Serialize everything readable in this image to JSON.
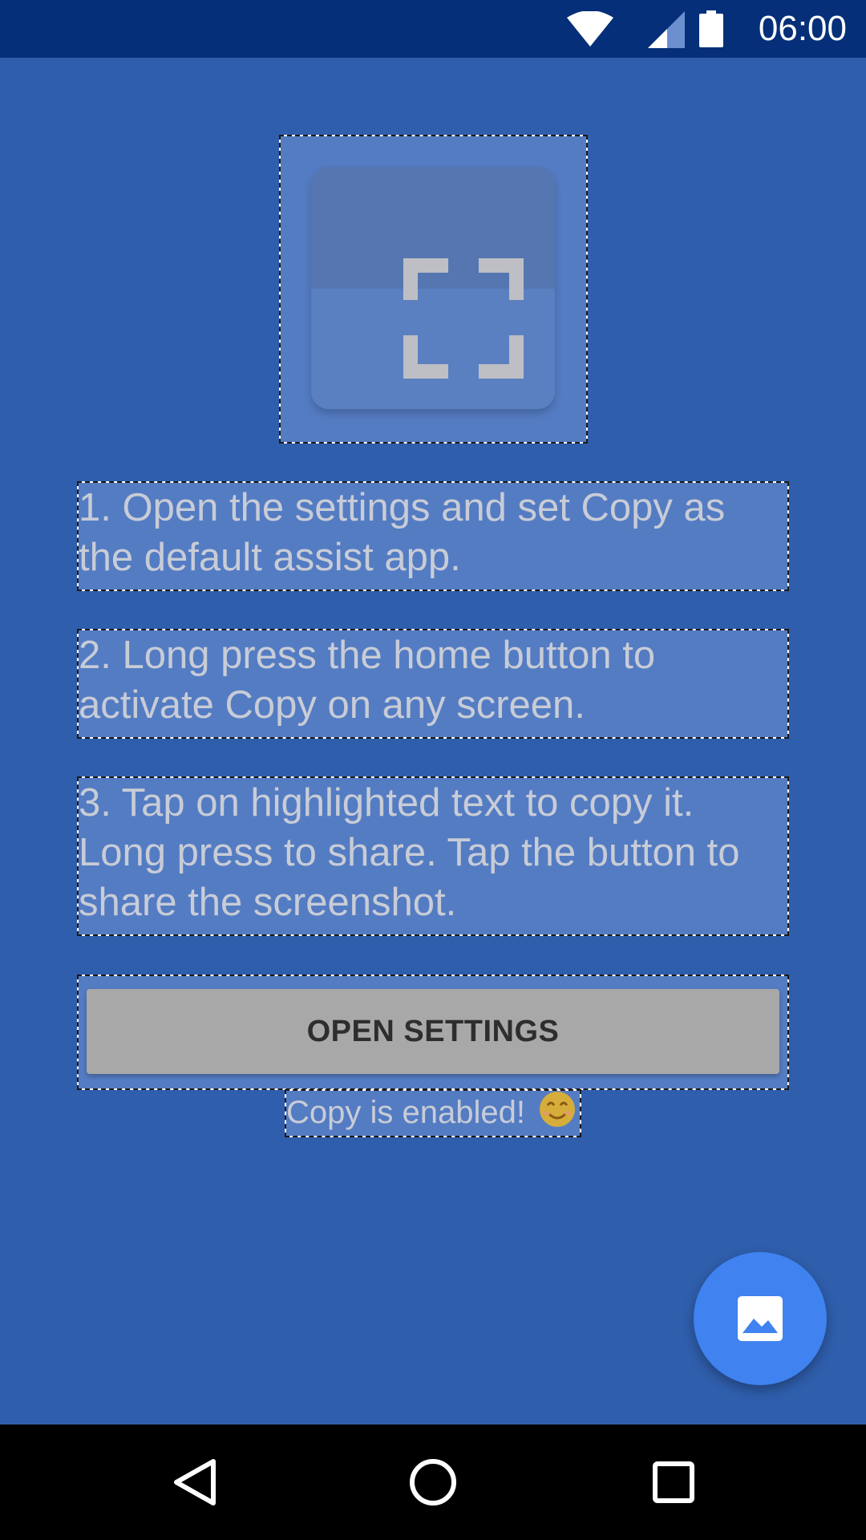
{
  "status_bar": {
    "time": "06:00",
    "icons": [
      "wifi-icon",
      "signal-icon",
      "battery-icon"
    ]
  },
  "logo": {
    "icon": "crop-frame-icon"
  },
  "steps": [
    "1. Open the settings and set Copy as the default assist app.",
    "2. Long press the home button to activate Copy on any screen.",
    "3. Tap on highlighted text to copy it. Long press to share. Tap the button to share the screenshot."
  ],
  "open_settings_label": "OPEN SETTINGS",
  "status_message": "Copy is enabled!",
  "status_emoji_icon": "smiling-face-icon",
  "fab": {
    "icon": "image-icon"
  },
  "nav_bar": {
    "icons": [
      "back-icon",
      "home-icon",
      "recents-icon"
    ]
  },
  "colors": {
    "background": "#2f5eac",
    "status_bar": "#052f78",
    "fab": "#3f82f0",
    "button": "#a8a8a8"
  }
}
